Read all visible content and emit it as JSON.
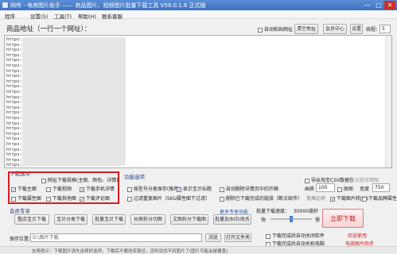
{
  "window": {
    "title": "网传 - 电商图片助手 —— 商品图片、视频图片批量下载工具 V59.0.1.6 正式版",
    "minimize": "—",
    "maximize": "□",
    "close": "✕"
  },
  "menu": [
    "程序",
    "设置(S)",
    "工具(T)",
    "帮助(H)",
    "联系客服"
  ],
  "url_section": {
    "label": "商品地址（一行一个网址）：",
    "auto_paste": "自动粘贴网址",
    "clear_button": "清空地址",
    "member_center": "会员中心",
    "settings_button": "设置",
    "threads_label": "线程：",
    "threads_value": "5",
    "url_prefix": "https://"
  },
  "download_options": {
    "title": "下载选项",
    "items": [
      {
        "label": "网址下载规格(主图、颜色、详情)",
        "checked": false
      },
      {
        "label": "下载主图",
        "checked": true
      },
      {
        "label": "下载视频",
        "checked": false
      },
      {
        "label": "下载手机详情",
        "checked": true
      },
      {
        "label": "下载属性图",
        "checked": false
      },
      {
        "label": "下载其他图",
        "checked": false
      },
      {
        "label": "下载评论图",
        "checked": true
      }
    ]
  },
  "function_options": {
    "title": "功能选项",
    "items": [
      {
        "label": "按型号分类保存(推荐)",
        "checked": false
      },
      {
        "label": "显示宝贝标题",
        "checked": true
      },
      {
        "label": "自动删除详情页中的开箱",
        "checked": false
      },
      {
        "label": "过滤重复图片（SKU属性图下过滤）",
        "checked": false
      },
      {
        "label": "删除已下载完成的链接（断点续传）",
        "checked": false
      }
    ]
  },
  "right_options": {
    "export_csv": "导出淘宝CSV数据包",
    "image_quality": "画质",
    "quality_value": "100",
    "original_size": "原图",
    "width_label": "宽度",
    "width_value": "750",
    "detail_note": "远程详情图",
    "convert": "下载图片转JPG",
    "ratio": "宽高比例",
    "check_attr": "下载品牌属性"
  },
  "member": {
    "title": "会员专享",
    "buttons": [
      "整店宝贝下载",
      "宝贝分类下载",
      "批量宝贝下载",
      "长图拆分切图",
      "文图拆分下载图",
      "批量加水印/改名"
    ],
    "more": "更多专享功能",
    "speed_label": "批量下载速度：",
    "speed_value": "30000毫秒",
    "fast": "快",
    "slow": "慢"
  },
  "save": {
    "label": "保存位置：",
    "path": "D:\\图片下载",
    "browse": "浏览",
    "open_folder": "打开文件夹"
  },
  "after": {
    "open_when_done": "下载完成后自动关闭软件",
    "shutdown_when_done": "下载完成后自动关机电脑"
  },
  "start_button": "立即下载",
  "welcome": "欢迎使用",
  "product": "电商图片助手",
  "tip": "友情提示：下载图片请先选择好选项，下载后不要改变路径，否则就找不到图片了(图片可能会被覆盖)",
  "url_rows": 25
}
